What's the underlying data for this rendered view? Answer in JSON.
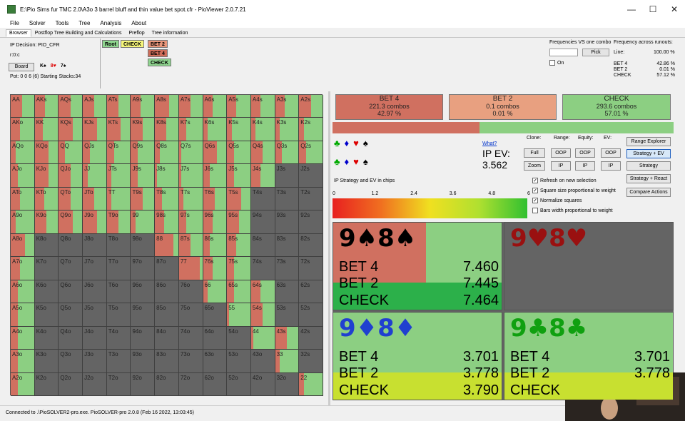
{
  "window": {
    "title": "E:\\Pio Sims fur TMC 2.0\\A3o 3 barrel bluff and thin value bet spot.cfr - PioViewer 2.0.7.21",
    "minimize": "—",
    "maximize": "☐",
    "close": "✕"
  },
  "menu": [
    "File",
    "Solver",
    "Tools",
    "Tree",
    "Analysis",
    "About"
  ],
  "tabs": [
    "Browser",
    "Postflop Tree Building and Calculations",
    "Preflop",
    "Tree information"
  ],
  "info": {
    "decision": "IP Decision:  PIO_CFR",
    "line": "r:0:c",
    "board_label": "Board",
    "board_cards": [
      {
        "t": "K♠",
        "c": "#000"
      },
      {
        "t": "8♥",
        "c": "#d00"
      },
      {
        "t": "7♠",
        "c": "#000"
      }
    ],
    "pot": "Pot: 0 0 6 (6) Starting Stacks:34"
  },
  "nodes": [
    {
      "label": "Root",
      "bg": "#8fd68f"
    },
    {
      "label": "CHECK",
      "bg": "#f5f57a"
    },
    {
      "label": "BET 2",
      "bg": "#e8967a"
    },
    {
      "label": "BET 4",
      "bg": "#d06d5a"
    },
    {
      "label": "CHECK",
      "bg": "#8fd68f"
    }
  ],
  "freq": {
    "vs_title": "Frequencies VS one combo",
    "pick": "Pick",
    "on": "On",
    "runouts_title": "Frequency across runouts:",
    "line_label": "Line:",
    "line_value": "100.00 %",
    "rows": [
      {
        "k": "BET 4",
        "v": "42.86 %"
      },
      {
        "k": "BET 2",
        "v": "0.01 %"
      },
      {
        "k": "CHECK",
        "v": "57.12 %"
      }
    ]
  },
  "grid": {
    "ranks": [
      "A",
      "K",
      "Q",
      "J",
      "T",
      "9",
      "8",
      "7",
      "6",
      "5",
      "4",
      "3",
      "2"
    ],
    "colors": {
      "bet4": "#d07060",
      "bet2": "#e8a080",
      "check": "#8ccf82",
      "empty": "#646464"
    },
    "cells": [
      [
        [
          0.5,
          0.5
        ],
        [
          0.45,
          0.55
        ],
        [
          0.5,
          0.5
        ],
        [
          0.5,
          0.5
        ],
        [
          0.5,
          0.5
        ],
        [
          0.4,
          0.6
        ],
        [
          0.6,
          0.4
        ],
        [
          0.5,
          0.5
        ],
        [
          0.4,
          0.6
        ],
        [
          0.4,
          0.6
        ],
        [
          0.4,
          0.6
        ],
        [
          0.4,
          0.6
        ],
        [
          0.5,
          0.5
        ]
      ],
      [
        [
          0.4,
          0.6
        ],
        [
          0.35,
          0.65
        ],
        [
          0.6,
          0.4
        ],
        [
          0.6,
          0.4
        ],
        [
          0.6,
          0.4
        ],
        [
          0.5,
          0.5
        ],
        [
          0.5,
          0.5
        ],
        [
          0.3,
          0.7
        ],
        [
          0.2,
          0.8
        ],
        [
          0.2,
          0.8
        ],
        [
          0.2,
          0.8
        ],
        [
          0.2,
          0.8
        ],
        [
          0.2,
          0.8
        ]
      ],
      [
        [
          0.2,
          0.8
        ],
        [
          0.6,
          0.4
        ],
        [
          0.25,
          0.75
        ],
        [
          0.3,
          0.7
        ],
        [
          0.3,
          0.7
        ],
        [
          0.3,
          0.7
        ],
        [
          0.2,
          0.8
        ],
        [
          0.1,
          0.9
        ],
        [
          0.6,
          0.4
        ],
        [
          0.3,
          0.7
        ],
        [
          0.5,
          0.5
        ],
        [
          0.3,
          0.7
        ],
        [
          0.3,
          0.7
        ]
      ],
      [
        [
          0.3,
          0.7
        ],
        [
          0.6,
          0.4
        ],
        [
          0.5,
          0.5
        ],
        [
          0.2,
          0.8
        ],
        [
          0.2,
          0.8
        ],
        [
          0.3,
          0.7
        ],
        [
          0.1,
          0.9
        ],
        [
          0.1,
          0.9
        ],
        [
          0.3,
          0.7
        ],
        [
          0.3,
          0.7
        ],
        [
          0.4,
          0.6
        ],
        [
          0,
          0
        ],
        [
          0,
          0
        ]
      ],
      [
        [
          0.4,
          0.6
        ],
        [
          0.4,
          0.6
        ],
        [
          0.5,
          0.5
        ],
        [
          0.5,
          0.5
        ],
        [
          0.2,
          0.8
        ],
        [
          0.5,
          0.5
        ],
        [
          0.3,
          0.7
        ],
        [
          0.2,
          0.8
        ],
        [
          0.5,
          0.5
        ],
        [
          0.6,
          0.4
        ],
        [
          0,
          0
        ],
        [
          0,
          0
        ],
        [
          0,
          0
        ]
      ],
      [
        [
          0.2,
          0.8
        ],
        [
          0.5,
          0.5
        ],
        [
          0.6,
          0.4
        ],
        [
          0.6,
          0.4
        ],
        [
          0.5,
          0.5
        ],
        [
          0.2,
          0.8
        ],
        [
          0.4,
          0.6
        ],
        [
          0.3,
          0.7
        ],
        [
          0.4,
          0.6
        ],
        [
          0.5,
          0.5
        ],
        [
          0,
          0
        ],
        [
          0,
          0
        ],
        [
          0,
          0
        ]
      ],
      [
        [
          0.6,
          0.4
        ],
        [
          0,
          0
        ],
        [
          0,
          0
        ],
        [
          0,
          0
        ],
        [
          0,
          0
        ],
        [
          0,
          0
        ],
        [
          0.8,
          0.2
        ],
        [
          0.5,
          0.5
        ],
        [
          0.3,
          0.7
        ],
        [
          0.4,
          0.6
        ],
        [
          0,
          0
        ],
        [
          0,
          0
        ],
        [
          0,
          0
        ]
      ],
      [
        [
          0.4,
          0.6
        ],
        [
          0,
          0
        ],
        [
          0,
          0
        ],
        [
          0,
          0
        ],
        [
          0,
          0
        ],
        [
          0,
          0
        ],
        [
          0,
          0
        ],
        [
          0.9,
          0.1
        ],
        [
          0.4,
          0.6
        ],
        [
          0.3,
          0.7
        ],
        [
          0,
          0
        ],
        [
          0,
          0
        ],
        [
          0,
          0
        ]
      ],
      [
        [
          0.3,
          0.7
        ],
        [
          0,
          0
        ],
        [
          0,
          0
        ],
        [
          0,
          0
        ],
        [
          0,
          0
        ],
        [
          0,
          0
        ],
        [
          0,
          0
        ],
        [
          0,
          0
        ],
        [
          0.2,
          0.8
        ],
        [
          0.3,
          0.7
        ],
        [
          0.4,
          0.6
        ],
        [
          0,
          0
        ],
        [
          0,
          0
        ]
      ],
      [
        [
          0.3,
          0.7
        ],
        [
          0,
          0
        ],
        [
          0,
          0
        ],
        [
          0,
          0
        ],
        [
          0,
          0
        ],
        [
          0,
          0
        ],
        [
          0,
          0
        ],
        [
          0,
          0
        ],
        [
          0,
          0
        ],
        [
          0.1,
          0.9
        ],
        [
          0.5,
          0.5
        ],
        [
          0,
          0
        ],
        [
          0,
          0
        ]
      ],
      [
        [
          0.3,
          0.7
        ],
        [
          0,
          0
        ],
        [
          0,
          0
        ],
        [
          0,
          0
        ],
        [
          0,
          0
        ],
        [
          0,
          0
        ],
        [
          0,
          0
        ],
        [
          0,
          0
        ],
        [
          0,
          0
        ],
        [
          0,
          0
        ],
        [
          0.1,
          0.9
        ],
        [
          0.5,
          0.5
        ],
        [
          0,
          0
        ]
      ],
      [
        [
          0.3,
          0.7
        ],
        [
          0,
          0
        ],
        [
          0,
          0
        ],
        [
          0,
          0
        ],
        [
          0,
          0
        ],
        [
          0,
          0
        ],
        [
          0,
          0
        ],
        [
          0,
          0
        ],
        [
          0,
          0
        ],
        [
          0,
          0
        ],
        [
          0,
          0
        ],
        [
          0.2,
          0.8
        ],
        [
          0,
          0
        ]
      ],
      [
        [
          0.3,
          0.7
        ],
        [
          0,
          0
        ],
        [
          0,
          0
        ],
        [
          0,
          0
        ],
        [
          0,
          0
        ],
        [
          0,
          0
        ],
        [
          0,
          0
        ],
        [
          0,
          0
        ],
        [
          0,
          0
        ],
        [
          0,
          0
        ],
        [
          0,
          0
        ],
        [
          0,
          0
        ],
        [
          0.2,
          0.8
        ]
      ]
    ]
  },
  "summary": [
    {
      "action": "BET 4",
      "combos": "221.3 combos",
      "pct": "42.97 %",
      "bg": "#d07060"
    },
    {
      "action": "BET 2",
      "combos": "0.1 combos",
      "pct": "0.01 %",
      "bg": "#e8a080"
    },
    {
      "action": "CHECK",
      "combos": "293.6 combos",
      "pct": "57.01 %",
      "bg": "#8ccf82"
    }
  ],
  "strip": [
    {
      "frac": 0.43,
      "bg": "#d07060"
    },
    {
      "frac": 0.57,
      "bg": "#8ccf82"
    }
  ],
  "suits": {
    "row1": [
      {
        "s": "♣",
        "c": "#0a0"
      },
      {
        "s": "♦",
        "c": "#00c"
      },
      {
        "s": "♥",
        "c": "#d00"
      },
      {
        "s": "♠",
        "c": "#000"
      }
    ],
    "row2": [
      {
        "s": "♣",
        "c": "#0a0"
      },
      {
        "s": "♦",
        "c": "#00c"
      },
      {
        "s": "♥",
        "c": "#d00"
      },
      {
        "s": "♠",
        "c": "#000"
      }
    ]
  },
  "ev": {
    "what": "What?",
    "label": "IP EV:",
    "value": "3.562"
  },
  "controls": {
    "clone": "Clone:",
    "range": "Range:",
    "equity": "Equity:",
    "evlabel": "EV:",
    "full": "Full",
    "zoom": "Zoom",
    "oop": "OOP",
    "ip": "IP",
    "right_buttons": [
      "Range Explorer",
      "Strategy + EV",
      "Strategy",
      "Strategy + React",
      "Compare Actions"
    ],
    "checks": [
      {
        "label": "Refresh on new selection",
        "checked": "✓"
      },
      {
        "label": "Square size proportional to weight",
        "checked": "✓"
      },
      {
        "label": "Normalize squares",
        "checked": "✓"
      },
      {
        "label": "Bars width proportional to weight",
        "checked": ""
      }
    ]
  },
  "legend": {
    "title": "IP Strategy and EV in chips",
    "ticks": [
      "0",
      "1.2",
      "2.4",
      "3.6",
      "4.8",
      "6"
    ]
  },
  "quadrants": [
    {
      "hand_parts": [
        {
          "t": "9♠8♠",
          "c": "#000"
        }
      ],
      "bet4": "7.460",
      "bet2": "7.445",
      "check": "7.464",
      "has_data": true,
      "top_split": 0.55,
      "check_bg": "#2cb04a"
    },
    {
      "hand_parts": [
        {
          "t": "9♥8♥",
          "c": "#9a1010"
        }
      ],
      "has_data": false
    },
    {
      "hand_parts": [
        {
          "t": "9♦8♦",
          "c": "#2040d0"
        }
      ],
      "bet4": "3.701",
      "bet2": "3.778",
      "check": "3.790",
      "has_data": true,
      "top_split": 0,
      "check_bg": "#c8e030"
    },
    {
      "hand_parts": [
        {
          "t": "9♣8♣",
          "c": "#10a010"
        }
      ],
      "bet4": "3.701",
      "bet2": "3.778",
      "check": "",
      "has_data": true,
      "top_split": 0,
      "check_bg": "#c8e030"
    }
  ],
  "action_labels": {
    "bet4": "BET 4",
    "bet2": "BET 2",
    "check": "CHECK"
  },
  "status": "Connected to .\\PioSOLVER2-pro.exe. PioSOLVER-pro 2.0.8 (Feb 16 2022, 13:03:45)"
}
